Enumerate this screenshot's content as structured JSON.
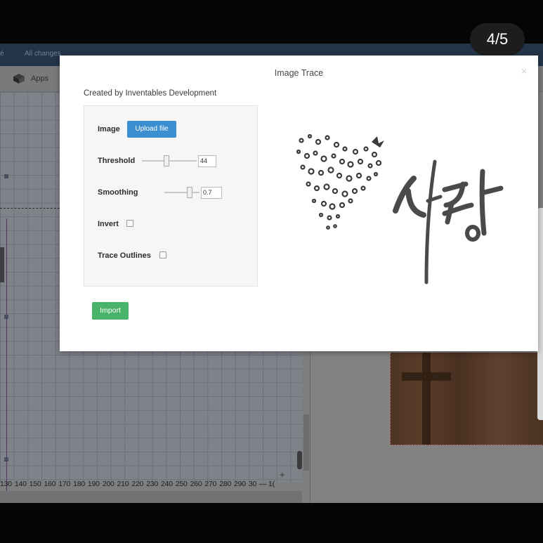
{
  "story": {
    "counter": "4/5"
  },
  "app": {
    "topnav": {
      "changes_text": "All changes",
      "left_glyph": "é"
    },
    "toolbar": {
      "apps_label": "Apps",
      "apps_icon": "cube-icon"
    },
    "ruler": {
      "ticks": [
        "130",
        "140",
        "150",
        "160",
        "170",
        "180",
        "190",
        "200",
        "210",
        "220",
        "230",
        "240",
        "250",
        "260",
        "270",
        "280",
        "290",
        "30",
        "— 1("
      ]
    },
    "zoom": {
      "plus": "+",
      "minus": "—"
    }
  },
  "modal": {
    "title": "Image Trace",
    "close_label": "×",
    "created_by": "Created by Inventables Development",
    "image_label": "Image",
    "upload_label": "Upload file",
    "threshold": {
      "label": "Threshold",
      "value": "44",
      "fraction": 0.44
    },
    "smoothing": {
      "label": "Smoothing",
      "value": "0.7",
      "fraction": 0.7
    },
    "invert": {
      "label": "Invert",
      "checked": false
    },
    "trace_outlines": {
      "label": "Trace Outlines",
      "checked": false
    },
    "import_label": "Import",
    "colors": {
      "upload": "#3b8fcf",
      "import": "#4ab36a",
      "ink": "#3a3a3a"
    },
    "preview_icon": "heart-lettering-image"
  }
}
